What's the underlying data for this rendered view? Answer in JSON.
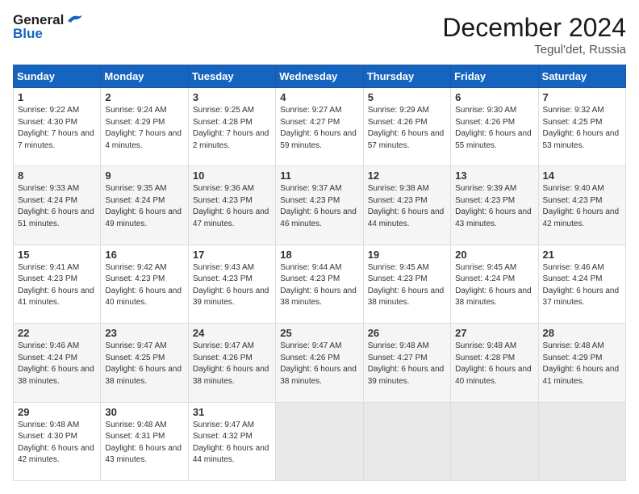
{
  "header": {
    "logo_general": "General",
    "logo_blue": "Blue",
    "month_title": "December 2024",
    "location": "Tegul'det, Russia"
  },
  "weekdays": [
    "Sunday",
    "Monday",
    "Tuesday",
    "Wednesday",
    "Thursday",
    "Friday",
    "Saturday"
  ],
  "weeks": [
    [
      {
        "day": "1",
        "sunrise": "9:22 AM",
        "sunset": "4:30 PM",
        "daylight": "7 hours and 7 minutes."
      },
      {
        "day": "2",
        "sunrise": "9:24 AM",
        "sunset": "4:29 PM",
        "daylight": "7 hours and 4 minutes."
      },
      {
        "day": "3",
        "sunrise": "9:25 AM",
        "sunset": "4:28 PM",
        "daylight": "7 hours and 2 minutes."
      },
      {
        "day": "4",
        "sunrise": "9:27 AM",
        "sunset": "4:27 PM",
        "daylight": "6 hours and 59 minutes."
      },
      {
        "day": "5",
        "sunrise": "9:29 AM",
        "sunset": "4:26 PM",
        "daylight": "6 hours and 57 minutes."
      },
      {
        "day": "6",
        "sunrise": "9:30 AM",
        "sunset": "4:26 PM",
        "daylight": "6 hours and 55 minutes."
      },
      {
        "day": "7",
        "sunrise": "9:32 AM",
        "sunset": "4:25 PM",
        "daylight": "6 hours and 53 minutes."
      }
    ],
    [
      {
        "day": "8",
        "sunrise": "9:33 AM",
        "sunset": "4:24 PM",
        "daylight": "6 hours and 51 minutes."
      },
      {
        "day": "9",
        "sunrise": "9:35 AM",
        "sunset": "4:24 PM",
        "daylight": "6 hours and 49 minutes."
      },
      {
        "day": "10",
        "sunrise": "9:36 AM",
        "sunset": "4:23 PM",
        "daylight": "6 hours and 47 minutes."
      },
      {
        "day": "11",
        "sunrise": "9:37 AM",
        "sunset": "4:23 PM",
        "daylight": "6 hours and 46 minutes."
      },
      {
        "day": "12",
        "sunrise": "9:38 AM",
        "sunset": "4:23 PM",
        "daylight": "6 hours and 44 minutes."
      },
      {
        "day": "13",
        "sunrise": "9:39 AM",
        "sunset": "4:23 PM",
        "daylight": "6 hours and 43 minutes."
      },
      {
        "day": "14",
        "sunrise": "9:40 AM",
        "sunset": "4:23 PM",
        "daylight": "6 hours and 42 minutes."
      }
    ],
    [
      {
        "day": "15",
        "sunrise": "9:41 AM",
        "sunset": "4:23 PM",
        "daylight": "6 hours and 41 minutes."
      },
      {
        "day": "16",
        "sunrise": "9:42 AM",
        "sunset": "4:23 PM",
        "daylight": "6 hours and 40 minutes."
      },
      {
        "day": "17",
        "sunrise": "9:43 AM",
        "sunset": "4:23 PM",
        "daylight": "6 hours and 39 minutes."
      },
      {
        "day": "18",
        "sunrise": "9:44 AM",
        "sunset": "4:23 PM",
        "daylight": "6 hours and 38 minutes."
      },
      {
        "day": "19",
        "sunrise": "9:45 AM",
        "sunset": "4:23 PM",
        "daylight": "6 hours and 38 minutes."
      },
      {
        "day": "20",
        "sunrise": "9:45 AM",
        "sunset": "4:24 PM",
        "daylight": "6 hours and 38 minutes."
      },
      {
        "day": "21",
        "sunrise": "9:46 AM",
        "sunset": "4:24 PM",
        "daylight": "6 hours and 37 minutes."
      }
    ],
    [
      {
        "day": "22",
        "sunrise": "9:46 AM",
        "sunset": "4:24 PM",
        "daylight": "6 hours and 38 minutes."
      },
      {
        "day": "23",
        "sunrise": "9:47 AM",
        "sunset": "4:25 PM",
        "daylight": "6 hours and 38 minutes."
      },
      {
        "day": "24",
        "sunrise": "9:47 AM",
        "sunset": "4:26 PM",
        "daylight": "6 hours and 38 minutes."
      },
      {
        "day": "25",
        "sunrise": "9:47 AM",
        "sunset": "4:26 PM",
        "daylight": "6 hours and 38 minutes."
      },
      {
        "day": "26",
        "sunrise": "9:48 AM",
        "sunset": "4:27 PM",
        "daylight": "6 hours and 39 minutes."
      },
      {
        "day": "27",
        "sunrise": "9:48 AM",
        "sunset": "4:28 PM",
        "daylight": "6 hours and 40 minutes."
      },
      {
        "day": "28",
        "sunrise": "9:48 AM",
        "sunset": "4:29 PM",
        "daylight": "6 hours and 41 minutes."
      }
    ],
    [
      {
        "day": "29",
        "sunrise": "9:48 AM",
        "sunset": "4:30 PM",
        "daylight": "6 hours and 42 minutes."
      },
      {
        "day": "30",
        "sunrise": "9:48 AM",
        "sunset": "4:31 PM",
        "daylight": "6 hours and 43 minutes."
      },
      {
        "day": "31",
        "sunrise": "9:47 AM",
        "sunset": "4:32 PM",
        "daylight": "6 hours and 44 minutes."
      },
      null,
      null,
      null,
      null
    ]
  ],
  "labels": {
    "sunrise": "Sunrise:",
    "sunset": "Sunset:",
    "daylight": "Daylight:"
  }
}
